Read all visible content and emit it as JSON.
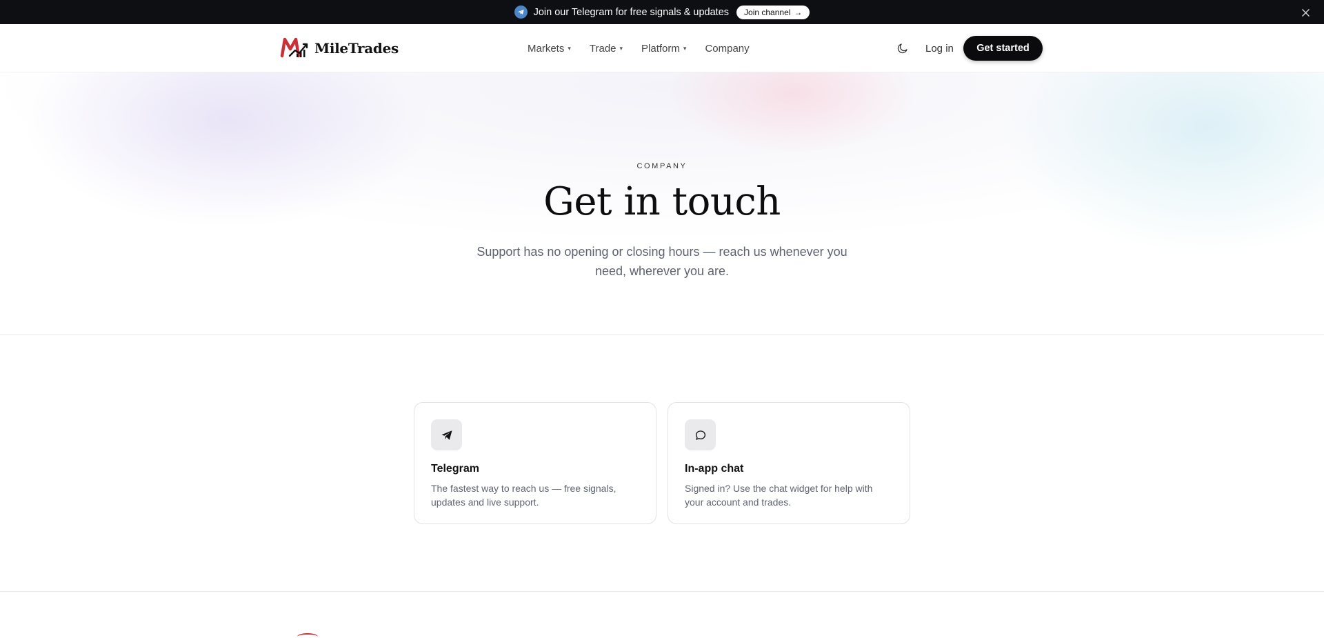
{
  "announcement": {
    "text": "Join our Telegram for free signals & updates",
    "button_label": "Join channel",
    "arrow": "→",
    "icons": [
      "telegram-icon",
      "arrow-right-icon",
      "close-icon"
    ]
  },
  "header": {
    "brand": "MileTrades",
    "nav": [
      {
        "label": "Markets",
        "caret": "▾"
      },
      {
        "label": "Trade",
        "caret": "▾"
      },
      {
        "label": "Platform",
        "caret": "▾"
      },
      {
        "label": "Company",
        "caret": ""
      }
    ],
    "login_label": "Log in",
    "cta_label": "Get started",
    "icons": [
      "moon-icon"
    ]
  },
  "hero": {
    "eyebrow": "COMPANY",
    "title": "Get in touch",
    "subtitle": "Support has no opening or closing hours — reach us whenever you need, wherever you are."
  },
  "cards": [
    {
      "icon": "paper-plane-icon",
      "title": "Telegram",
      "text": "The fastest way to reach us — free signals, updates and live support."
    },
    {
      "icon": "chat-bubble-icon",
      "title": "In-app chat",
      "text": "Signed in? Use the chat widget for help with your account and trades."
    }
  ],
  "colors": {
    "announce_bg": "#0e0f12",
    "brand_red": "#c93038",
    "cta_bg": "#0b0b0d",
    "telegram_blue": "#4c86c6"
  }
}
